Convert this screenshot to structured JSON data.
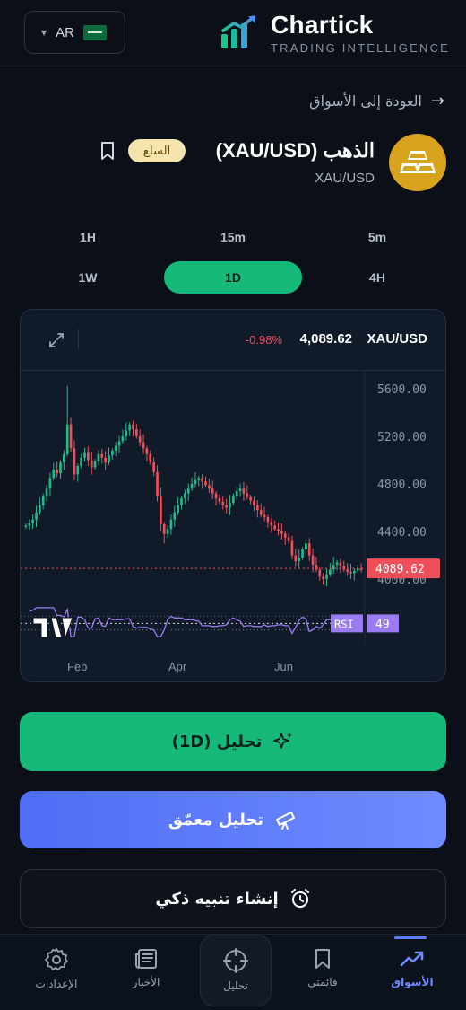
{
  "header": {
    "lang_code": "AR",
    "logo_title": "Chartick",
    "logo_subtitle": "TRADING INTELLIGENCE"
  },
  "back_label": "العودة إلى الأسواق",
  "asset": {
    "title": "الذهب (XAU/USD)",
    "symbol": "XAU/USD",
    "badge": "السلع",
    "icon": "gold-bars-icon",
    "icon_color": "#d7a21d"
  },
  "timeframes": [
    {
      "label": "5m",
      "active": false
    },
    {
      "label": "15m",
      "active": false
    },
    {
      "label": "1H",
      "active": false
    },
    {
      "label": "4H",
      "active": false
    },
    {
      "label": "1D",
      "active": true
    },
    {
      "label": "1W",
      "active": false
    }
  ],
  "chart": {
    "symbol": "XAU/USD",
    "price": "4,089.62",
    "change": "-0.98%",
    "price_tag": "4089.62",
    "rsi_label": "RSI",
    "rsi_value": "49",
    "logo": "TV"
  },
  "chart_data": {
    "type": "candlestick",
    "y_ticks": [
      "5600.00",
      "5200.00",
      "4800.00",
      "4400.00",
      "4000.00"
    ],
    "x_ticks": [
      "Feb",
      "Apr",
      "Jun"
    ],
    "ylim": [
      3700,
      5700
    ],
    "last_price": 4089.62,
    "closes": [
      4450,
      4470,
      4500,
      4560,
      4620,
      4700,
      4760,
      4850,
      4920,
      4890,
      4980,
      5050,
      5300,
      5100,
      4880,
      4950,
      5020,
      5060,
      5000,
      4940,
      4990,
      5050,
      5020,
      4980,
      5040,
      5080,
      5120,
      5160,
      5200,
      5250,
      5300,
      5260,
      5200,
      5150,
      5100,
      5050,
      4980,
      4900,
      4700,
      4460,
      4380,
      4420,
      4500,
      4560,
      4620,
      4680,
      4720,
      4760,
      4800,
      4830,
      4850,
      4820,
      4790,
      4760,
      4720,
      4680,
      4650,
      4620,
      4600,
      4640,
      4700,
      4740,
      4760,
      4720,
      4690,
      4660,
      4620,
      4580,
      4540,
      4520,
      4480,
      4450,
      4420,
      4400,
      4380,
      4350,
      4320,
      4200,
      4150,
      4180,
      4250,
      4300,
      4200,
      4120,
      4080,
      4020,
      4000,
      4040,
      4080,
      4120,
      4140,
      4110,
      4080,
      4060,
      4050,
      4070,
      4090,
      4089.62
    ],
    "rsi_level": 49,
    "rsi_levels": [
      30,
      70
    ]
  },
  "buttons": {
    "analysis": "تحليل (1D)",
    "deep": "تحليل معمّق",
    "alert": "إنشاء تنبيه ذكي"
  },
  "nav": [
    {
      "label": "الأسواق",
      "icon": "trend-up-icon",
      "active": true
    },
    {
      "label": "قائمتي",
      "icon": "bookmark-icon",
      "active": false
    },
    {
      "label": "تحليل",
      "icon": "crosshair-icon",
      "active": false
    },
    {
      "label": "الأخبار",
      "icon": "newspaper-icon",
      "active": false
    },
    {
      "label": "الإعدادات",
      "icon": "gear-icon",
      "active": false
    }
  ],
  "colors": {
    "accent_green": "#16b97a",
    "accent_blue": "#5b7cff",
    "down_red": "#ef4f5a",
    "rsi_purple": "#9b7cf0"
  }
}
